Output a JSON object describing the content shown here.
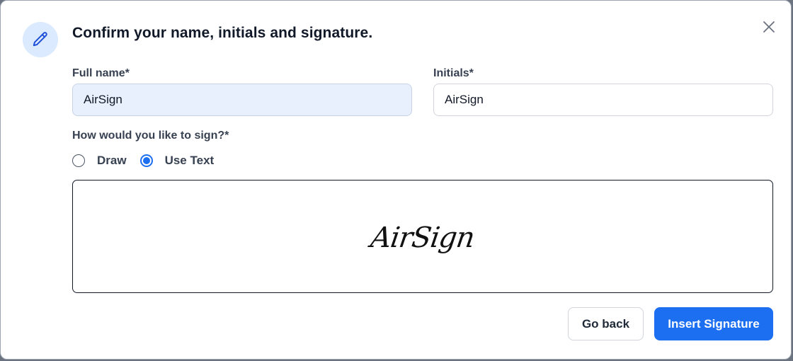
{
  "dialog": {
    "title": "Confirm your name, initials and signature.",
    "header_icon": "pencil-icon",
    "close_icon": "close-icon"
  },
  "fields": {
    "full_name": {
      "label": "Full name*",
      "value": "AirSign"
    },
    "initials": {
      "label": "Initials*",
      "value": "AirSign"
    }
  },
  "sign_method": {
    "question": "How would you like to sign?*",
    "options": [
      {
        "label": "Draw",
        "checked": false
      },
      {
        "label": "Use Text",
        "checked": true
      }
    ]
  },
  "signature_preview": {
    "text": "AirSign"
  },
  "actions": {
    "back_label": "Go back",
    "insert_label": "Insert Signature"
  },
  "colors": {
    "primary": "#1d6ff2",
    "icon_bg": "#dbeafe",
    "autofill_bg": "#e8f0fe"
  }
}
